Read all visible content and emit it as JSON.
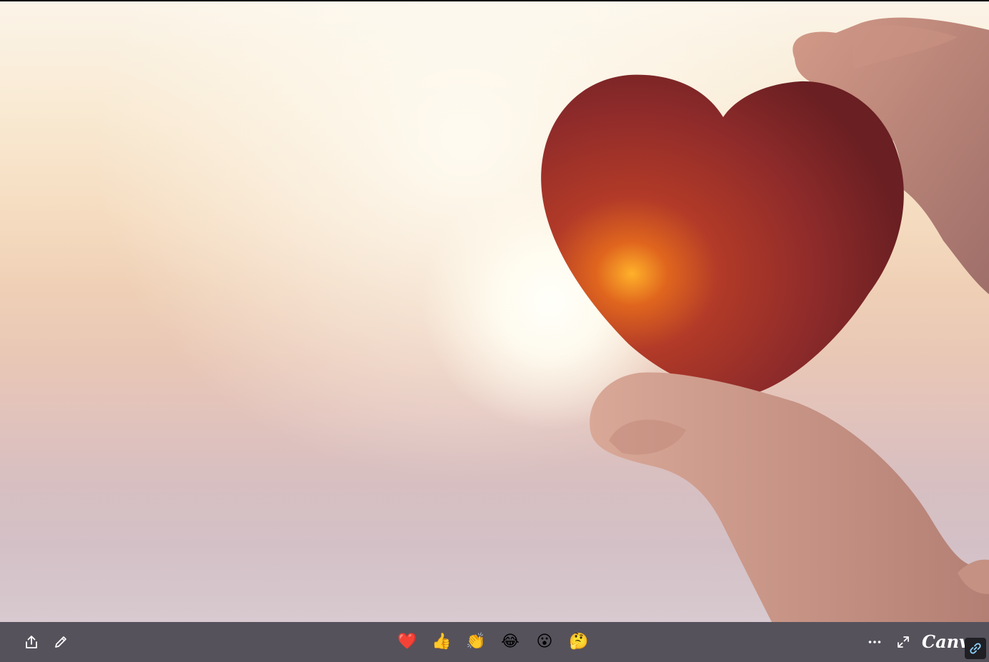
{
  "toolbar": {
    "share_icon": "share-icon",
    "edit_icon": "pencil-icon",
    "more_icon": "more-horizontal-icon",
    "fullscreen_icon": "expand-icon",
    "link_icon": "link-icon",
    "brand_text": "Canva",
    "background_color": "#55525c"
  },
  "reactions": [
    {
      "emoji": "❤️",
      "icon": "heart-reaction"
    },
    {
      "emoji": "👍",
      "icon": "thumbs-up-reaction"
    },
    {
      "emoji": "👏",
      "icon": "clapping-reaction"
    },
    {
      "emoji": "😂",
      "icon": "laughing-reaction"
    },
    {
      "emoji": "😮",
      "icon": "surprised-reaction"
    },
    {
      "emoji": "🤔",
      "icon": "thinking-reaction"
    }
  ],
  "slide": {
    "image_subject": "hand-holding-red-heart-at-sunset",
    "heart_color": "#a8302a"
  }
}
